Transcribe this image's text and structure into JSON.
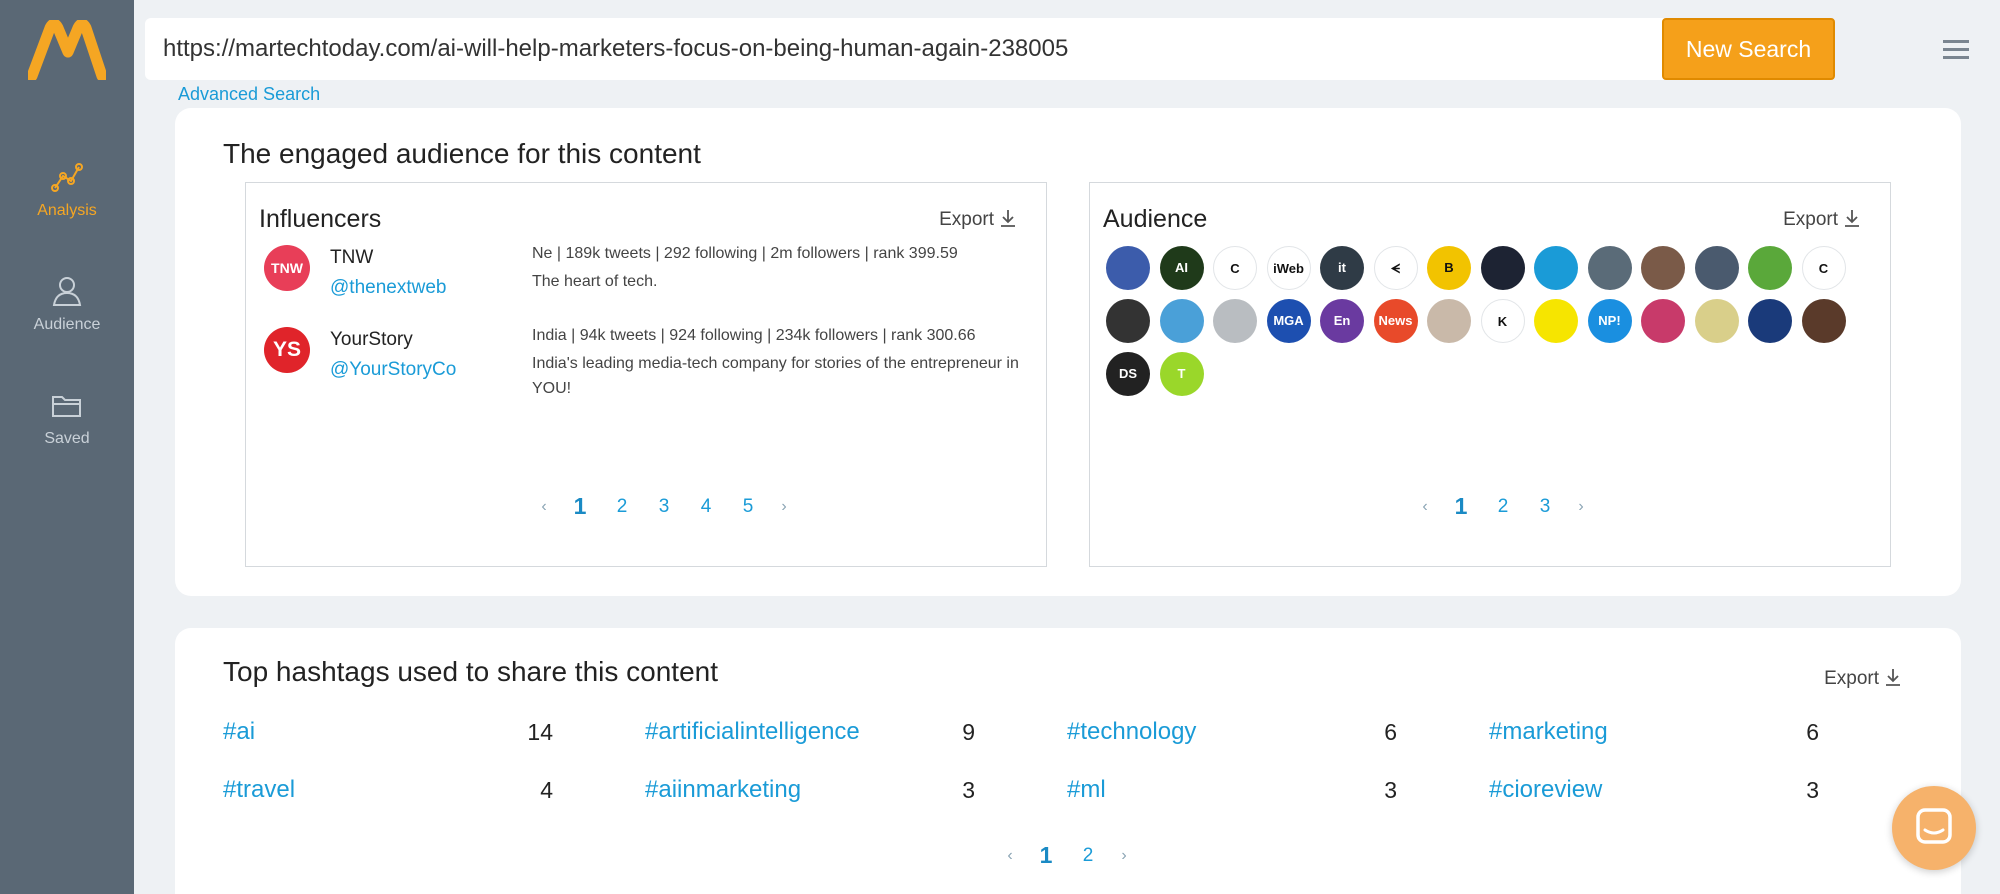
{
  "sidebar": {
    "items": [
      {
        "label": "Analysis",
        "icon": "analysis-chart-icon",
        "active": true
      },
      {
        "label": "Audience",
        "icon": "user-icon",
        "active": false
      },
      {
        "label": "Saved",
        "icon": "folder-icon",
        "active": false
      }
    ]
  },
  "search": {
    "url": "https://martechtoday.com/ai-will-help-marketers-focus-on-being-human-again-238005",
    "button_label": "New Search",
    "advanced_label": "Advanced Search"
  },
  "engaged": {
    "title": "The engaged audience for this content",
    "influencers": {
      "title": "Influencers",
      "export_label": "Export",
      "items": [
        {
          "name": "TNW",
          "handle": "@thenextweb",
          "avatar_text": "TNW",
          "avatar_color": "#e83e58",
          "stats": "Ne | 189k tweets | 292 following | 2m followers | rank 399.59",
          "bio": "The heart of tech."
        },
        {
          "name": "YourStory",
          "handle": "@YourStoryCo",
          "avatar_text": "YS",
          "avatar_color": "#e0242a",
          "stats": "India | 94k tweets | 924 following | 234k followers | rank 300.66",
          "bio": "India's leading media-tech company for stories of the entrepreneur in YOU!"
        }
      ],
      "pager": {
        "prev": "‹",
        "pages": [
          "1",
          "2",
          "3",
          "4",
          "5"
        ],
        "current": "1",
        "next": "›"
      }
    },
    "audience": {
      "title": "Audience",
      "export_label": "Export",
      "avatars": [
        {
          "text": "",
          "color": "#3c5cab"
        },
        {
          "text": "AI",
          "color": "#1f3a1a"
        },
        {
          "text": "C",
          "color": "#ffffff"
        },
        {
          "text": "iWeb",
          "color": "#ffffff"
        },
        {
          "text": "it",
          "color": "#2f3b46"
        },
        {
          "text": "ᗕ",
          "color": "#ffffff"
        },
        {
          "text": "B",
          "color": "#f2c300"
        },
        {
          "text": "",
          "color": "#1d2333"
        },
        {
          "text": "",
          "color": "#1a9bd7"
        },
        {
          "text": "",
          "color": "#5a6b78"
        },
        {
          "text": "",
          "color": "#7a5a48"
        },
        {
          "text": "",
          "color": "#4a5a6e"
        },
        {
          "text": "",
          "color": "#5aa83a"
        },
        {
          "text": "C",
          "color": "#ffffff"
        },
        {
          "text": "",
          "color": "#333333"
        },
        {
          "text": "",
          "color": "#4aa0d8"
        },
        {
          "text": "",
          "color": "#b9bdc1"
        },
        {
          "text": "MGA",
          "color": "#1d4fb0"
        },
        {
          "text": "En",
          "color": "#6a3aa0"
        },
        {
          "text": "News",
          "color": "#e84a2a"
        },
        {
          "text": "",
          "color": "#c9b9a9"
        },
        {
          "text": "K",
          "color": "#ffffff"
        },
        {
          "text": "",
          "color": "#f6e500"
        },
        {
          "text": "NP!",
          "color": "#1a8fe0"
        },
        {
          "text": "",
          "color": "#c83a6a"
        },
        {
          "text": "",
          "color": "#d9cf8a"
        },
        {
          "text": "",
          "color": "#1a3a7a"
        },
        {
          "text": "",
          "color": "#5a3a2a"
        },
        {
          "text": "DS",
          "color": "#222222"
        },
        {
          "text": "T",
          "color": "#9ad72a"
        }
      ],
      "pager": {
        "prev": "‹",
        "pages": [
          "1",
          "2",
          "3"
        ],
        "current": "1",
        "next": "›"
      }
    }
  },
  "hashtags": {
    "title": "Top hashtags used to share this content",
    "export_label": "Export",
    "items": [
      {
        "tag": "#ai",
        "count": "14"
      },
      {
        "tag": "#artificialintelligence",
        "count": "9"
      },
      {
        "tag": "#technology",
        "count": "6"
      },
      {
        "tag": "#marketing",
        "count": "6"
      },
      {
        "tag": "#travel",
        "count": "4"
      },
      {
        "tag": "#aiinmarketing",
        "count": "3"
      },
      {
        "tag": "#ml",
        "count": "3"
      },
      {
        "tag": "#cioreview",
        "count": "3"
      }
    ],
    "pager": {
      "prev": "‹",
      "pages": [
        "1",
        "2"
      ],
      "current": "1",
      "next": "›"
    }
  },
  "colors": {
    "accent": "#f5a623",
    "link": "#1a9bd7",
    "sidebar": "#5a6875"
  }
}
